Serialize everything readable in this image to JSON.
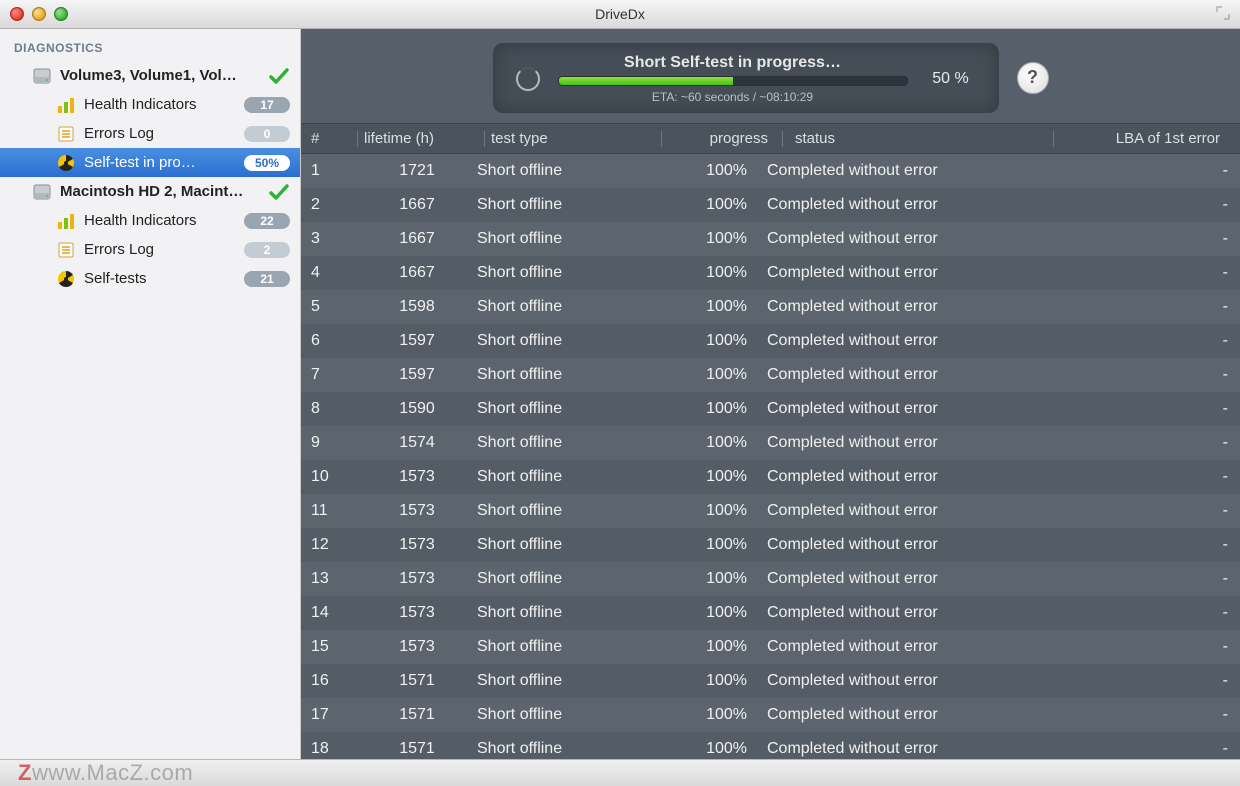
{
  "app_title": "DriveDx",
  "sidebar": {
    "heading": "DIAGNOSTICS",
    "drives": [
      {
        "name": "Volume3, Volume1, Vol…",
        "status": "ok",
        "children": [
          {
            "id": "health",
            "label": "Health Indicators",
            "badge": "17",
            "badge_style": "normal"
          },
          {
            "id": "errors",
            "label": "Errors Log",
            "badge": "0",
            "badge_style": "light"
          },
          {
            "id": "selftest",
            "label": "Self-test in pro…",
            "badge": "50%",
            "badge_style": "normal",
            "selected": true
          }
        ]
      },
      {
        "name": "Macintosh HD 2, Macint…",
        "status": "ok",
        "children": [
          {
            "id": "health",
            "label": "Health Indicators",
            "badge": "22",
            "badge_style": "normal"
          },
          {
            "id": "errors",
            "label": "Errors Log",
            "badge": "2",
            "badge_style": "light"
          },
          {
            "id": "selftest",
            "label": "Self-tests",
            "badge": "21",
            "badge_style": "normal"
          }
        ]
      }
    ]
  },
  "progress_banner": {
    "title": "Short Self-test in progress…",
    "eta": "ETA: ~60 seconds / ~08:10:29",
    "percent_label": "50 %",
    "percent_value": 50
  },
  "table": {
    "headers": {
      "idx": "#",
      "lifetime": "lifetime (h)",
      "test_type": "test type",
      "progress": "progress",
      "status": "status",
      "lba": "LBA of 1st error"
    },
    "rows": [
      {
        "idx": "1",
        "lifetime": "1721",
        "type": "Short offline",
        "progress": "100%",
        "status": "Completed without error",
        "lba": "-"
      },
      {
        "idx": "2",
        "lifetime": "1667",
        "type": "Short offline",
        "progress": "100%",
        "status": "Completed without error",
        "lba": "-"
      },
      {
        "idx": "3",
        "lifetime": "1667",
        "type": "Short offline",
        "progress": "100%",
        "status": "Completed without error",
        "lba": "-"
      },
      {
        "idx": "4",
        "lifetime": "1667",
        "type": "Short offline",
        "progress": "100%",
        "status": "Completed without error",
        "lba": "-"
      },
      {
        "idx": "5",
        "lifetime": "1598",
        "type": "Short offline",
        "progress": "100%",
        "status": "Completed without error",
        "lba": "-"
      },
      {
        "idx": "6",
        "lifetime": "1597",
        "type": "Short offline",
        "progress": "100%",
        "status": "Completed without error",
        "lba": "-"
      },
      {
        "idx": "7",
        "lifetime": "1597",
        "type": "Short offline",
        "progress": "100%",
        "status": "Completed without error",
        "lba": "-"
      },
      {
        "idx": "8",
        "lifetime": "1590",
        "type": "Short offline",
        "progress": "100%",
        "status": "Completed without error",
        "lba": "-"
      },
      {
        "idx": "9",
        "lifetime": "1574",
        "type": "Short offline",
        "progress": "100%",
        "status": "Completed without error",
        "lba": "-"
      },
      {
        "idx": "10",
        "lifetime": "1573",
        "type": "Short offline",
        "progress": "100%",
        "status": "Completed without error",
        "lba": "-"
      },
      {
        "idx": "11",
        "lifetime": "1573",
        "type": "Short offline",
        "progress": "100%",
        "status": "Completed without error",
        "lba": "-"
      },
      {
        "idx": "12",
        "lifetime": "1573",
        "type": "Short offline",
        "progress": "100%",
        "status": "Completed without error",
        "lba": "-"
      },
      {
        "idx": "13",
        "lifetime": "1573",
        "type": "Short offline",
        "progress": "100%",
        "status": "Completed without error",
        "lba": "-"
      },
      {
        "idx": "14",
        "lifetime": "1573",
        "type": "Short offline",
        "progress": "100%",
        "status": "Completed without error",
        "lba": "-"
      },
      {
        "idx": "15",
        "lifetime": "1573",
        "type": "Short offline",
        "progress": "100%",
        "status": "Completed without error",
        "lba": "-"
      },
      {
        "idx": "16",
        "lifetime": "1571",
        "type": "Short offline",
        "progress": "100%",
        "status": "Completed without error",
        "lba": "-"
      },
      {
        "idx": "17",
        "lifetime": "1571",
        "type": "Short offline",
        "progress": "100%",
        "status": "Completed without error",
        "lba": "-"
      },
      {
        "idx": "18",
        "lifetime": "1571",
        "type": "Short offline",
        "progress": "100%",
        "status": "Completed without error",
        "lba": "-"
      }
    ]
  },
  "watermark": "www.MacZ.com"
}
